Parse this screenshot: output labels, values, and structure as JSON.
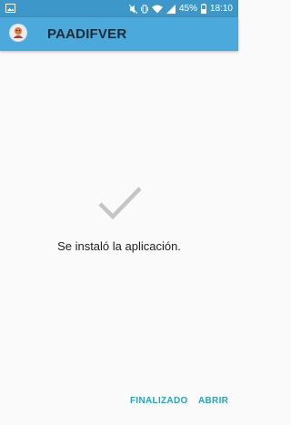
{
  "status_bar": {
    "battery_percent": "45%",
    "time": "18:10",
    "icons": [
      "image-icon",
      "mute-icon",
      "vibrate-icon",
      "wifi-icon",
      "cellular-signal-icon",
      "battery-icon"
    ]
  },
  "app_bar": {
    "title": "PAADIFVER",
    "icon": "app-logo-icon"
  },
  "main": {
    "icon": "checkmark-icon",
    "message": "Se instaló la aplicación."
  },
  "actions": {
    "finish_label": "FINALIZADO",
    "open_label": "ABRIR"
  },
  "colors": {
    "status_bar": "#3e97c9",
    "app_bar": "#4ca9dc",
    "accent": "#2aa3b8",
    "check": "#c5c5c5"
  }
}
